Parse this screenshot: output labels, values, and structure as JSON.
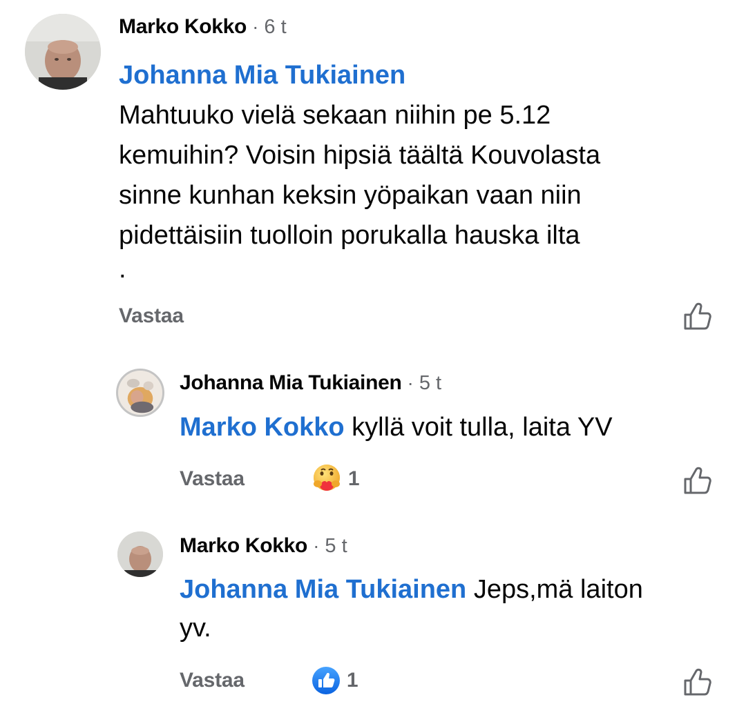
{
  "comments": [
    {
      "author": "Marko Kokko",
      "time": "6 t",
      "mention": "Johanna Mia Tukiainen",
      "text_lines": [
        "Mahtuuko vielä sekaan niihin pe 5.12",
        "kemuihin? Voisin hipsiä täältä Kouvolasta",
        "sinne kunhan keksin yöpaikan vaan niin",
        "pidettäisiin tuolloin porukalla hauska ilta",
        "."
      ],
      "reply_label": "Vastaa"
    },
    {
      "author": "Johanna Mia Tukiainen",
      "time": "5 t",
      "mention": "Marko Kokko",
      "text": " kyllä voit tulla, laita YV",
      "reply_label": "Vastaa",
      "reaction": {
        "icon": "care-emoji-icon",
        "count": "1"
      }
    },
    {
      "author": "Marko Kokko",
      "time": "5 t",
      "mention": "Johanna Mia Tukiainen",
      "text": " Jeps,mä laiton",
      "text_line2": "yv.",
      "reply_label": "Vastaa",
      "reaction": {
        "icon": "like-reaction-icon",
        "count": "1"
      }
    }
  ],
  "colors": {
    "mention": "#1f6fd0",
    "muted": "#65676b",
    "text": "#050505",
    "like_blue": "#1877f2"
  },
  "icons": {
    "like_button": "thumbs-up-outline-icon"
  }
}
